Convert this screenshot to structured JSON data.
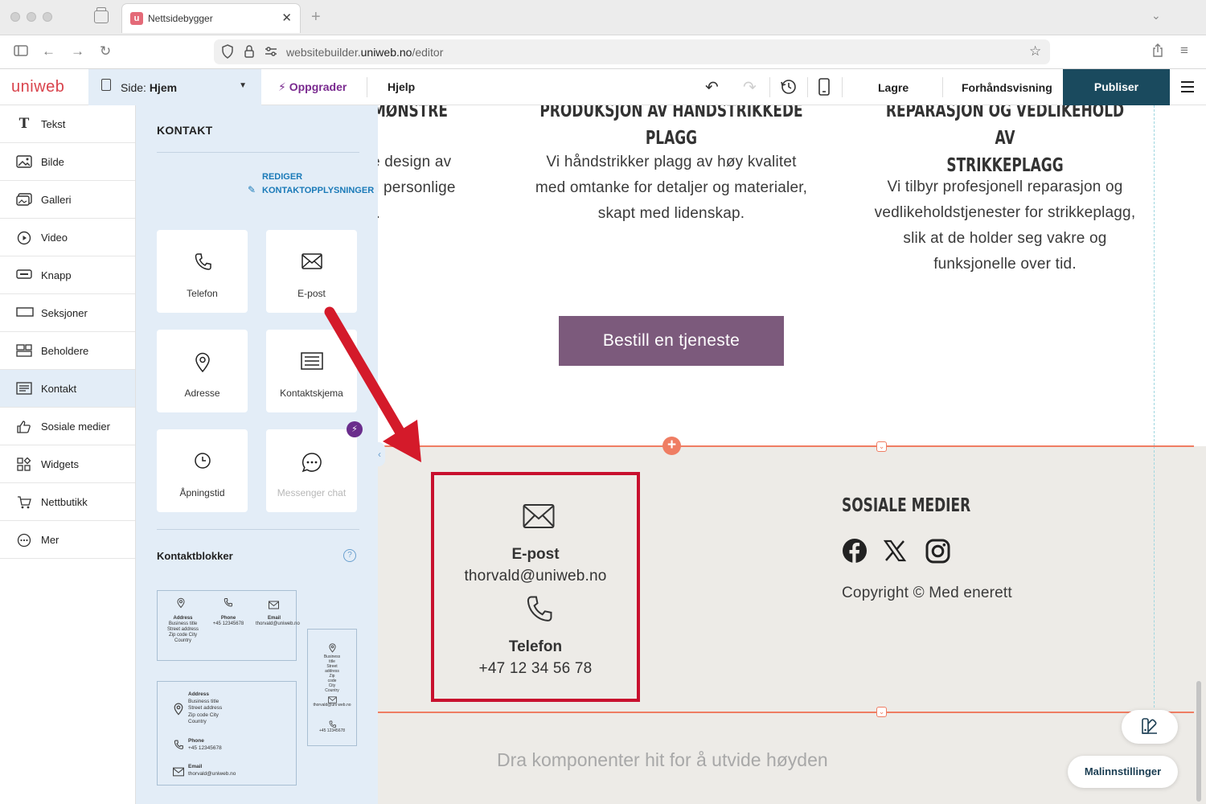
{
  "browser": {
    "tab_title": "Nettsidebygger",
    "tab_favicon_letter": "u",
    "url_prefix": "websitebuilder.",
    "url_domain": "uniweb.no",
    "url_path": "/editor"
  },
  "app": {
    "logo": "uniweb",
    "page_select_label": "Side:",
    "page_select_value": "Hjem",
    "upgrade_label": "Oppgrader",
    "help_label": "Hjelp",
    "save_label": "Lagre",
    "preview_label": "Forhåndsvisning",
    "publish_label": "Publiser"
  },
  "sidebar": {
    "items": [
      {
        "label": "Tekst",
        "icon": "text-icon"
      },
      {
        "label": "Bilde",
        "icon": "image-icon"
      },
      {
        "label": "Galleri",
        "icon": "gallery-icon"
      },
      {
        "label": "Video",
        "icon": "video-icon"
      },
      {
        "label": "Knapp",
        "icon": "button-icon"
      },
      {
        "label": "Seksjoner",
        "icon": "sections-icon"
      },
      {
        "label": "Beholdere",
        "icon": "containers-icon"
      },
      {
        "label": "Kontakt",
        "icon": "contact-icon",
        "active": true
      },
      {
        "label": "Sosiale medier",
        "icon": "thumbs-up-icon"
      },
      {
        "label": "Widgets",
        "icon": "widgets-icon"
      },
      {
        "label": "Nettbutikk",
        "icon": "cart-icon"
      },
      {
        "label": "Mer",
        "icon": "more-icon"
      }
    ]
  },
  "panel": {
    "title": "KONTAKT",
    "edit_link": "REDIGER KONTAKTOPPLYSNINGER",
    "cards": [
      {
        "label": "Telefon",
        "icon": "phone-icon"
      },
      {
        "label": "E-post",
        "icon": "envelope-icon"
      },
      {
        "label": "Adresse",
        "icon": "map-pin-icon"
      },
      {
        "label": "Kontaktskjema",
        "icon": "form-icon"
      },
      {
        "label": "Åpningstid",
        "icon": "clock-icon"
      },
      {
        "label": "Messenger chat",
        "icon": "chat-icon",
        "disabled": true
      }
    ],
    "blocks_title": "Kontaktblokker",
    "help_mark": "?",
    "template_a": {
      "address_label": "Address",
      "address_lines": [
        "Business title",
        "Street address",
        "Zip code City",
        "Country"
      ],
      "phone_label": "Phone",
      "phone_value": "+45 12345678",
      "email_label": "Email",
      "email_value": "thorvald@uniweb.no"
    },
    "template_b": {
      "address_label": "Address",
      "address_lines": [
        "Business title",
        "Street address",
        "Zip code City",
        "Country"
      ],
      "phone_label": "Phone",
      "phone_value": "+45 12345678",
      "email_label": "Email",
      "email_value": "thorvald@uniweb.no"
    },
    "template_c": {
      "address_lines": [
        "Business",
        "title",
        "Street",
        "address",
        "Zip",
        "code",
        "City",
        "Country"
      ],
      "email_value": "thorvald@uni web.no",
      "phone_value": "+45 12345678"
    }
  },
  "canvas": {
    "services": [
      {
        "title": "MØNSTRE",
        "text_lines": [
          "e design av",
          "og personlige",
          "t."
        ]
      },
      {
        "title": "PRODUKSJON AV HÅNDSTRIKKEDE PLAGG",
        "text_lines": [
          "Vi håndstrikker plagg av høy kvalitet",
          "med omtanke for detaljer og materialer,",
          "skapt med lidenskap."
        ]
      },
      {
        "title_lines": [
          "REPARASJON OG VEDLIKEHOLD AV",
          "STRIKKEPLAGG"
        ],
        "text_lines": [
          "Vi tilbyr profesjonell reparasjon og",
          "vedlikeholdstjenester for strikkeplagg,",
          "slik at de holder seg vakre og",
          "funksjonelle over tid."
        ]
      }
    ],
    "cta_label": "Bestill en tjeneste",
    "contact": {
      "email_label": "E-post",
      "email_value": "thorvald@uniweb.no",
      "phone_label": "Telefon",
      "phone_value": "+47 12 34 56 78"
    },
    "social": {
      "title": "SOSIALE MEDIER",
      "icons": [
        "facebook-icon",
        "x-icon",
        "instagram-icon"
      ]
    },
    "copyright": "Copyright © Med enerett",
    "drop_hint": "Dra komponenter hit for å utvide høyden",
    "template_settings_label": "Malinnstillinger"
  },
  "colors": {
    "accent_publish": "#1a4a5e",
    "cta": "#7c5a7c",
    "selection": "#ef7d63",
    "highlight_box": "#c8102e",
    "panel_bg": "#e3edf7"
  }
}
